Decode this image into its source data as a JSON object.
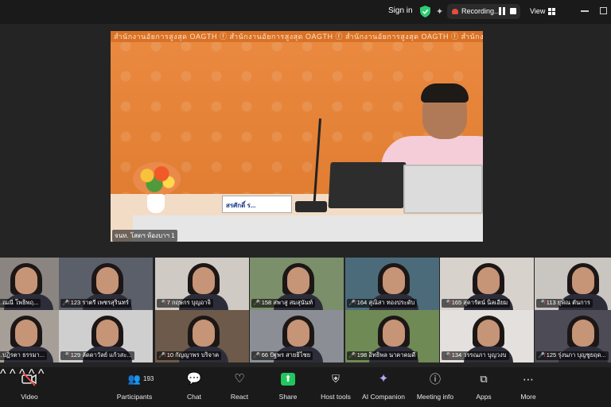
{
  "topbar": {
    "signin_label": "Sign in",
    "recording_label": "Recording...",
    "view_label": "View"
  },
  "speaker": {
    "banner_text": "สำนักงานอัยการสูงสุด OAGTH  ⓕ สำนักงานอัยการสูงสุด OAGTH  ⓕ สำนักงานอัยการสูงสุด OAGTH  ⓕ สำนักงาน",
    "nameplate": "สรศักดิ์ ร...",
    "name_label": "จนท. โสตฯ ห้องบาฯ 1"
  },
  "participants": [
    {
      "label": "...ณณี โพธิพฤ...",
      "bg": "#8a8580"
    },
    {
      "label": "123 ราตรี เพชรสุรินทร์",
      "bg": "#5b5f6a"
    },
    {
      "label": "7 กฤษกร บุญอาจิ",
      "bg": "#cfcac4"
    },
    {
      "label": "158 สพาสู สมสุนันท์",
      "bg": "#7a8f6a"
    },
    {
      "label": "164 สุณิสา ทองประดับ",
      "bg": "#4b6b7a"
    },
    {
      "label": "165 สุดารัตน์ นิลเอียม",
      "bg": "#d8d2cc"
    },
    {
      "label": "113 ยุพิณ ตันการ",
      "bg": "#c9c6c2"
    },
    {
      "label": "...ปฏิรตา ธรรมา...",
      "bg": "#a59f98"
    },
    {
      "label": "129 ลัดดาวัลย์ แก้วสะ...",
      "bg": "#cfcfcf"
    },
    {
      "label": "10 กัญญาพร บริจาค",
      "bg": "#6d5a4a"
    },
    {
      "label": "66 ปัฐพร สายธิไชย",
      "bg": "#8b8f95"
    },
    {
      "label": "198 อิทธิพล นาคาคมดี",
      "bg": "#6f8a55"
    },
    {
      "label": "134 วรรณภา บุญวงบ",
      "bg": "#e3e0dd"
    },
    {
      "label": "125 รุ่งนภา บุญชูยฤด...",
      "bg": "#4d4b55"
    }
  ],
  "toolbar": {
    "video": "Video",
    "participants": "Participants",
    "participant_count": "193",
    "chat": "Chat",
    "react": "React",
    "share": "Share",
    "host_tools": "Host tools",
    "ai_companion": "AI Companion",
    "meeting_info": "Meeting info",
    "apps": "Apps",
    "more": "More"
  },
  "colors": {
    "share_green": "#22c55e",
    "mute_red": "#ff4d4d",
    "recording_red": "#e74c3c"
  }
}
